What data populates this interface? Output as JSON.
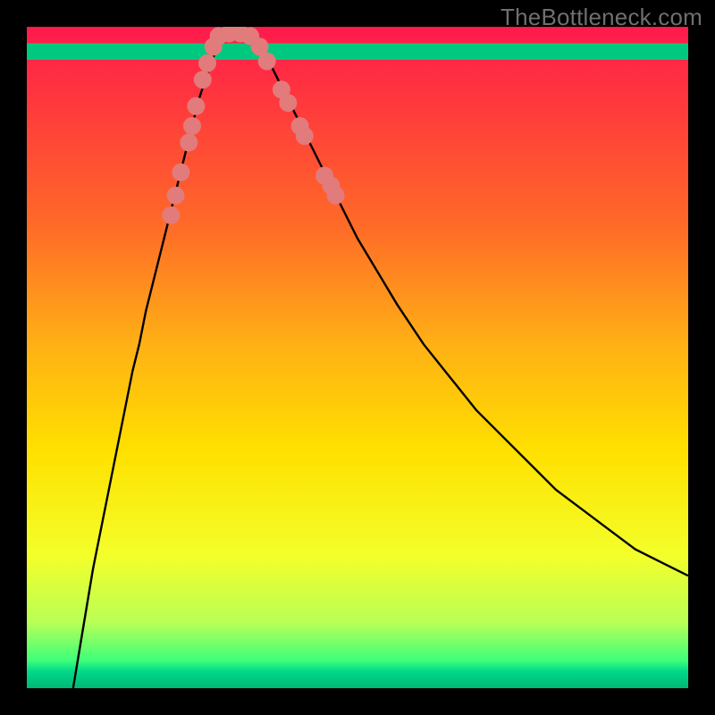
{
  "watermark": "TheBottleneck.com",
  "chart_data": {
    "type": "line",
    "title": "",
    "xlabel": "",
    "ylabel": "",
    "xlim": [
      0,
      100
    ],
    "ylim": [
      0,
      100
    ],
    "grid": false,
    "legend": false,
    "gradient_stops": [
      {
        "offset": 0.0,
        "color": "#ff1a4d"
      },
      {
        "offset": 0.12,
        "color": "#ff3a3c"
      },
      {
        "offset": 0.3,
        "color": "#ff6a28"
      },
      {
        "offset": 0.48,
        "color": "#ffb015"
      },
      {
        "offset": 0.64,
        "color": "#ffe000"
      },
      {
        "offset": 0.8,
        "color": "#f3ff2a"
      },
      {
        "offset": 0.9,
        "color": "#b9ff55"
      },
      {
        "offset": 0.958,
        "color": "#3eff7a"
      },
      {
        "offset": 0.975,
        "color": "#00d889"
      },
      {
        "offset": 1.0,
        "color": "#00b877"
      }
    ],
    "green_band": {
      "y0": 95.0,
      "y1": 97.5
    },
    "series": [
      {
        "name": "curve",
        "color": "#000000",
        "x": [
          7,
          8,
          9,
          10,
          11,
          12,
          13,
          14,
          15,
          16,
          17,
          18,
          19,
          20,
          21,
          22,
          23,
          24,
          25,
          26,
          27,
          28,
          29,
          30,
          31,
          33,
          35,
          37,
          38,
          40,
          42,
          44,
          46,
          48,
          50,
          53,
          56,
          60,
          64,
          68,
          72,
          76,
          80,
          84,
          88,
          92,
          96,
          98,
          100
        ],
        "y": [
          0,
          6,
          12,
          18,
          23,
          28,
          33,
          38,
          43,
          48,
          52,
          57,
          61,
          65,
          69,
          73,
          77,
          81,
          85,
          89,
          92,
          95,
          97,
          99,
          99,
          99,
          97,
          94,
          92,
          88,
          84,
          80,
          76,
          72,
          68,
          63,
          58,
          52,
          47,
          42,
          38,
          34,
          30,
          27,
          24,
          21,
          19,
          18,
          17
        ]
      }
    ],
    "markers": {
      "color": "#e27b7b",
      "radius_px": 10,
      "points": [
        {
          "x": 21.8,
          "y": 71.5
        },
        {
          "x": 22.5,
          "y": 74.5
        },
        {
          "x": 23.3,
          "y": 78.0
        },
        {
          "x": 24.5,
          "y": 82.5
        },
        {
          "x": 25.0,
          "y": 85.0
        },
        {
          "x": 25.6,
          "y": 88.0
        },
        {
          "x": 26.6,
          "y": 92.0
        },
        {
          "x": 27.3,
          "y": 94.5
        },
        {
          "x": 28.2,
          "y": 97.0
        },
        {
          "x": 29.0,
          "y": 98.6
        },
        {
          "x": 30.6,
          "y": 99.0
        },
        {
          "x": 32.3,
          "y": 99.0
        },
        {
          "x": 33.8,
          "y": 98.6
        },
        {
          "x": 35.2,
          "y": 97.0
        },
        {
          "x": 36.3,
          "y": 94.8
        },
        {
          "x": 38.5,
          "y": 90.5
        },
        {
          "x": 39.5,
          "y": 88.5
        },
        {
          "x": 41.3,
          "y": 85.0
        },
        {
          "x": 42.0,
          "y": 83.5
        },
        {
          "x": 45.0,
          "y": 77.5
        },
        {
          "x": 46.0,
          "y": 76.0
        },
        {
          "x": 46.7,
          "y": 74.5
        }
      ]
    }
  }
}
